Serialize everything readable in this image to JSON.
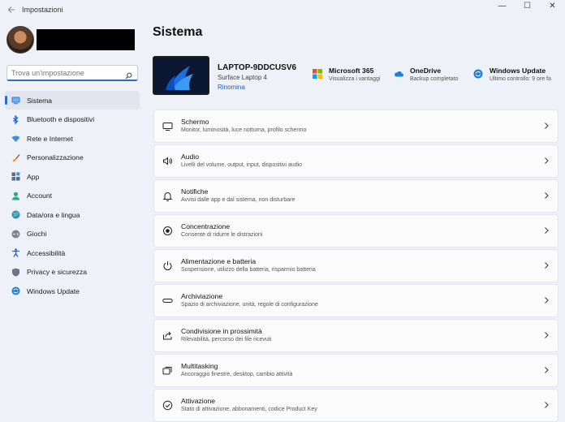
{
  "window": {
    "title": "Impostazioni",
    "controls": [
      "—",
      "☐",
      "✕"
    ]
  },
  "search": {
    "placeholder": "Trova un'impostazione"
  },
  "sidebar": {
    "items": [
      {
        "label": "Sistema",
        "icon": "system-icon",
        "active": true
      },
      {
        "label": "Bluetooth e dispositivi",
        "icon": "bluetooth-icon"
      },
      {
        "label": "Rete e Internet",
        "icon": "wifi-icon"
      },
      {
        "label": "Personalizzazione",
        "icon": "brush-icon"
      },
      {
        "label": "App",
        "icon": "apps-icon"
      },
      {
        "label": "Account",
        "icon": "account-icon"
      },
      {
        "label": "Data/ora e lingua",
        "icon": "globe-clock-icon"
      },
      {
        "label": "Giochi",
        "icon": "gamepad-icon"
      },
      {
        "label": "Accessibilità",
        "icon": "accessibility-icon"
      },
      {
        "label": "Privacy e sicurezza",
        "icon": "shield-icon"
      },
      {
        "label": "Windows Update",
        "icon": "update-icon"
      }
    ]
  },
  "main": {
    "title": "Sistema",
    "device": {
      "name": "LAPTOP-9DDCUSV6",
      "model": "Surface Laptop 4",
      "rename": "Rinomina"
    },
    "tiles": [
      {
        "title": "Microsoft 365",
        "subtitle": "Visualizza i vantaggi",
        "icon": "microsoft-logo-icon"
      },
      {
        "title": "OneDrive",
        "subtitle": "Backup completato",
        "icon": "cloud-icon"
      },
      {
        "title": "Windows Update",
        "subtitle": "Ultimo controllo: 9 ore fa",
        "icon": "update-icon"
      }
    ],
    "cards": [
      {
        "title": "Schermo",
        "subtitle": "Monitor, luminosità, luce notturna, profilo schermo",
        "icon": "monitor-icon"
      },
      {
        "title": "Audio",
        "subtitle": "Livelli del volume, output, input, dispositivi audio",
        "icon": "speaker-icon"
      },
      {
        "title": "Notifiche",
        "subtitle": "Avvisi dalle app e dal sistema, non disturbare",
        "icon": "bell-icon"
      },
      {
        "title": "Concentrazione",
        "subtitle": "Consente di ridurre le distrazioni",
        "icon": "focus-icon"
      },
      {
        "title": "Alimentazione e batteria",
        "subtitle": "Sospensione, utilizzo della batteria, risparmio batteria",
        "icon": "power-icon"
      },
      {
        "title": "Archiviazione",
        "subtitle": "Spazio di archiviazione, unità, regole di configurazione",
        "icon": "storage-icon"
      },
      {
        "title": "Condivisione in prossimità",
        "subtitle": "Rilevabilità, percorso dei file ricevuti",
        "icon": "share-icon"
      },
      {
        "title": "Multitasking",
        "subtitle": "Ancoraggio finestre, desktop, cambio attività",
        "icon": "multitasking-icon"
      },
      {
        "title": "Attivazione",
        "subtitle": "Stato di attivazione, abbonamenti, codice Product Key",
        "icon": "activation-check-icon"
      }
    ]
  }
}
